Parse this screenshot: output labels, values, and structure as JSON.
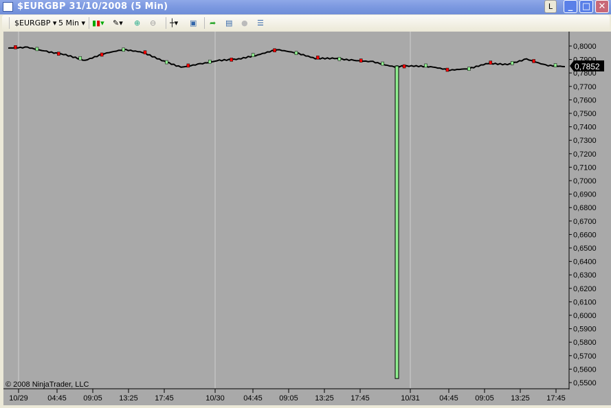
{
  "window": {
    "title": "$EURGBP  31/10/2008 (5 Min)",
    "l_button": "L",
    "minimize": "_",
    "maximize": "□",
    "close": "✕"
  },
  "toolbar": {
    "instrument": "$EURGBP",
    "interval": "5 Min",
    "icons": [
      "candlestick-icon",
      "pencil-icon",
      "zoom-in-icon",
      "zoom-out-icon",
      "crosshair-icon",
      "properties-icon",
      "instrument-icon",
      "chart-icon",
      "currency-icon",
      "data-box-icon"
    ]
  },
  "chart": {
    "copyright": "© 2008 NinjaTrader, LLC",
    "last_price": "0,7852",
    "colors": {
      "background": "#a9a9a9",
      "up": "#90ee90",
      "down": "#ff0000",
      "price_marker": "#000000"
    }
  },
  "chart_data": {
    "type": "candlestick",
    "title": "$EURGBP  31/10/2008 (5 Min)",
    "ylim": [
      0.55,
      0.8
    ],
    "y_ticks": [
      "0,8000",
      "0,7900",
      "0,7800",
      "0,7700",
      "0,7600",
      "0,7500",
      "0,7400",
      "0,7300",
      "0,7200",
      "0,7100",
      "0,7000",
      "0,6900",
      "0,6800",
      "0,6700",
      "0,6600",
      "0,6500",
      "0,6400",
      "0,6300",
      "0,6200",
      "0,6100",
      "0,6000",
      "0,5900",
      "0,5800",
      "0,5700",
      "0,5600",
      "0,5500"
    ],
    "x_ticks": [
      "10/29",
      "04:45",
      "09:05",
      "13:25",
      "17:45",
      "10/30",
      "04:45",
      "09:05",
      "13:25",
      "17:45",
      "10/31",
      "04:45",
      "09:05",
      "13:25",
      "17:45"
    ],
    "close_series": [
      0.7985,
      0.799,
      0.7959,
      0.7934,
      0.7893,
      0.7944,
      0.7974,
      0.7954,
      0.7893,
      0.7842,
      0.7867,
      0.7893,
      0.7903,
      0.7934,
      0.7974,
      0.7949,
      0.7908,
      0.7908,
      0.7893,
      0.7883,
      0.7847,
      0.7852,
      0.7847,
      0.7821,
      0.7832,
      0.7872,
      0.7862,
      0.7903,
      0.7857,
      0.7847
    ],
    "spike_bar": {
      "open": 0.785,
      "high": 0.7852,
      "low": 0.553,
      "close": 0.7848,
      "direction": "up"
    },
    "last": 0.7852
  }
}
